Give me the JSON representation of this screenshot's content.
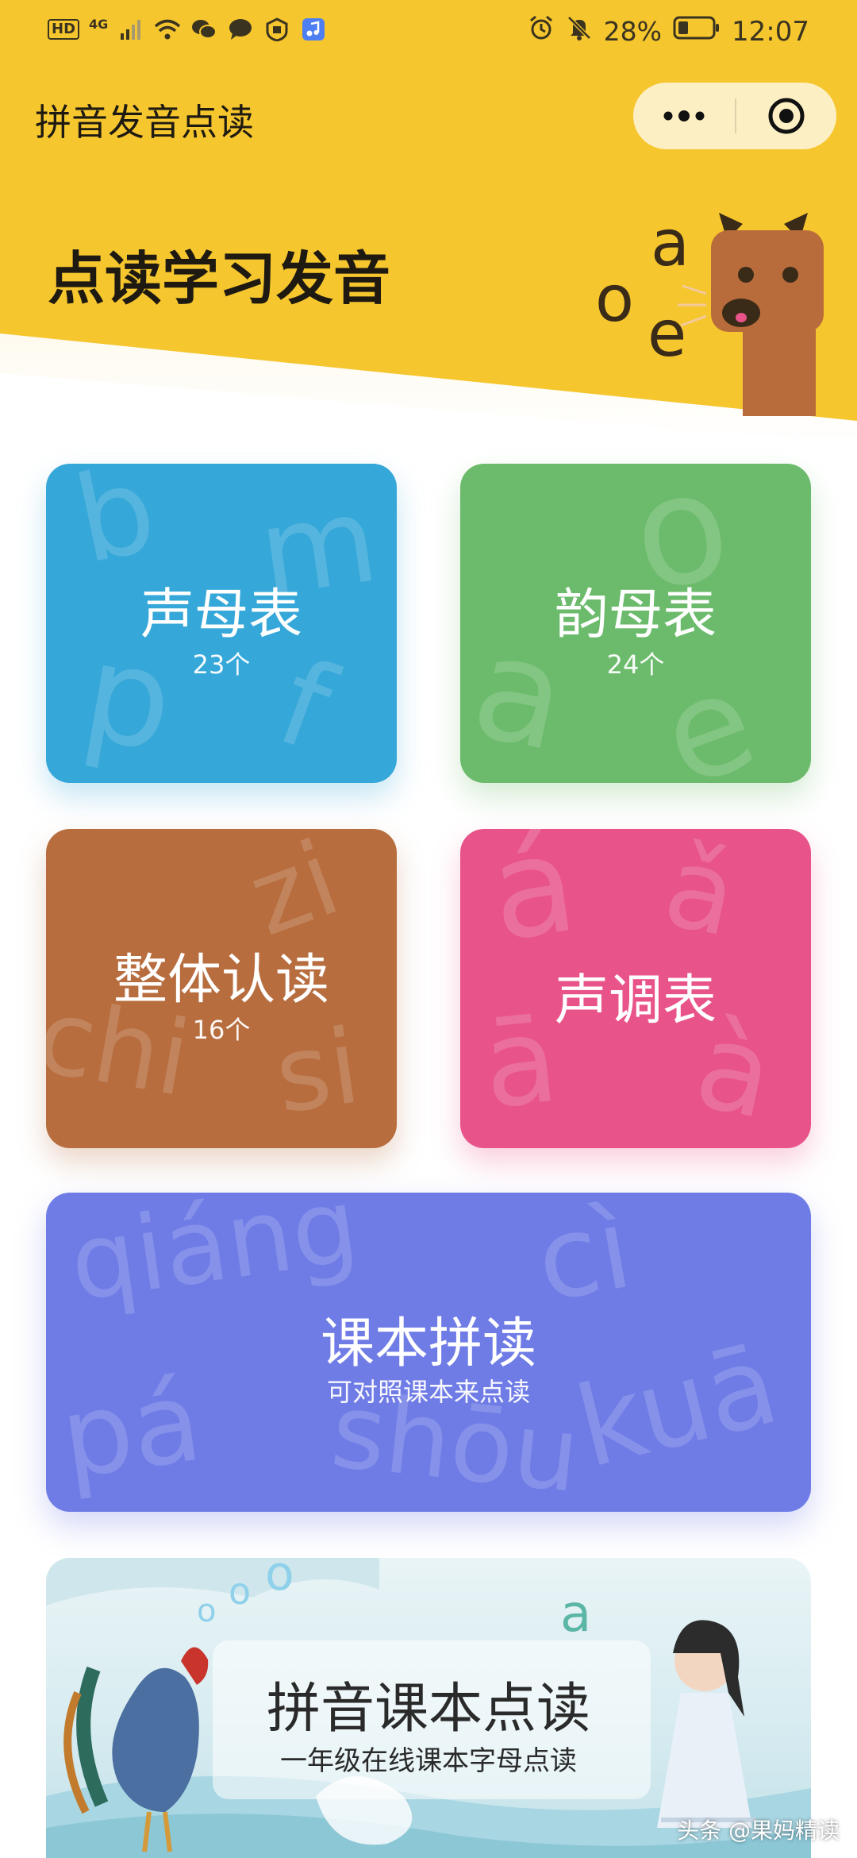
{
  "status_bar": {
    "left_badge": "HD",
    "network": "4G",
    "battery_percent": "28%",
    "time": "12:07"
  },
  "app": {
    "title": "拼音发音点读",
    "heading": "点读学习发音"
  },
  "mascot": {
    "letters": [
      "a",
      "o",
      "e"
    ]
  },
  "cards": {
    "initials": {
      "title": "声母表",
      "count": "23个",
      "deco": [
        "b",
        "m",
        "p",
        "f"
      ]
    },
    "finals": {
      "title": "韵母表",
      "count": "24个",
      "deco": [
        "o",
        "a",
        "e"
      ]
    },
    "whole_syllables": {
      "title": "整体认读",
      "count": "16个",
      "deco": [
        "zi",
        "chi",
        "si"
      ]
    },
    "tones": {
      "title": "声调表",
      "deco": [
        "á",
        "ǎ",
        "ā",
        "à"
      ]
    },
    "textbook": {
      "title": "课本拼读",
      "subtitle": "可对照课本来点读",
      "deco": [
        "qiáng",
        "cì",
        "pá",
        "shōu",
        "kuā"
      ]
    }
  },
  "banner": {
    "title": "拼音课本点读",
    "subtitle": "一年级在线课本字母点读",
    "deco": [
      "o",
      "o",
      "o",
      "a"
    ]
  },
  "watermark": "头条 @果妈精读",
  "colors": {
    "header": "#f6c62e",
    "blue": "#35a7d8",
    "green": "#6cbb6c",
    "brown": "#b76d3e",
    "pink": "#e8548a",
    "purple": "#6f7ce6"
  }
}
